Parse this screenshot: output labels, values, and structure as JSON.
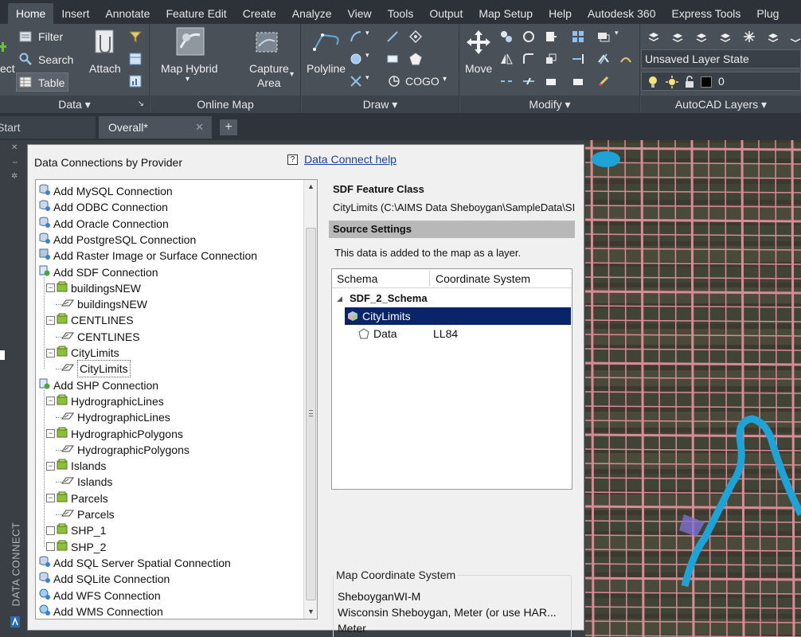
{
  "menu": {
    "tabs": [
      "Home",
      "Insert",
      "Annotate",
      "Feature Edit",
      "Create",
      "Analyze",
      "View",
      "Tools",
      "Output",
      "Map Setup",
      "Help",
      "Autodesk 360",
      "Express Tools",
      "Plug"
    ],
    "active": "Home"
  },
  "ribbon": {
    "data_panel": {
      "title": "Data",
      "connect_label": "ect",
      "filter_label": "Filter",
      "search_label": "Search",
      "table_label": "Table",
      "attach_label": "Attach"
    },
    "online_map_panel": {
      "title": "Online Map",
      "map_hybrid_label": "Map Hybrid",
      "capture_area_label_1": "Capture",
      "capture_area_label_2": "Area"
    },
    "draw_panel": {
      "title": "Draw",
      "polyline_label": "Polyline",
      "cogo_label": "COGO"
    },
    "modify_panel": {
      "title": "Modify",
      "move_label": "Move"
    },
    "layers_panel": {
      "title": "AutoCAD Layers",
      "layer_state": "Unsaved Layer State",
      "current_layer": "0"
    }
  },
  "doc_tabs": {
    "start": "Start",
    "overall": "Overall*"
  },
  "side_label": "DATA CONNECT",
  "dialog": {
    "title": "Data Connections by Provider",
    "help_icon": "?",
    "help_link": "Data Connect help",
    "tree": [
      {
        "label": "Add MySQL Connection",
        "level": 0,
        "icon": "db-connect"
      },
      {
        "label": "Add ODBC Connection",
        "level": 0,
        "icon": "db-connect"
      },
      {
        "label": "Add Oracle Connection",
        "level": 0,
        "icon": "db-connect"
      },
      {
        "label": "Add PostgreSQL Connection",
        "level": 0,
        "icon": "db-connect"
      },
      {
        "label": "Add Raster Image or Surface Connection",
        "level": 0,
        "icon": "raster-connect"
      },
      {
        "label": "Add SDF Connection",
        "level": 0,
        "icon": "file-connect"
      },
      {
        "label": "buildingsNEW",
        "level": 1,
        "icon": "datastore"
      },
      {
        "label": "buildingsNEW",
        "level": 2,
        "icon": "feature-class"
      },
      {
        "label": "CENTLINES",
        "level": 1,
        "icon": "datastore"
      },
      {
        "label": "CENTLINES",
        "level": 2,
        "icon": "feature-class"
      },
      {
        "label": "CityLimits",
        "level": 1,
        "icon": "datastore"
      },
      {
        "label": "CityLimits",
        "level": 2,
        "icon": "feature-class",
        "boxed": true
      },
      {
        "label": "Add SHP Connection",
        "level": 0,
        "icon": "file-connect"
      },
      {
        "label": "HydrographicLines",
        "level": 1,
        "icon": "datastore"
      },
      {
        "label": "HydrographicLines",
        "level": 2,
        "icon": "feature-class"
      },
      {
        "label": "HydrographicPolygons",
        "level": 1,
        "icon": "datastore"
      },
      {
        "label": "HydrographicPolygons",
        "level": 2,
        "icon": "feature-class"
      },
      {
        "label": "Islands",
        "level": 1,
        "icon": "datastore"
      },
      {
        "label": "Islands",
        "level": 2,
        "icon": "feature-class"
      },
      {
        "label": "Parcels",
        "level": 1,
        "icon": "datastore"
      },
      {
        "label": "Parcels",
        "level": 2,
        "icon": "feature-class"
      },
      {
        "label": "SHP_1",
        "level": 1,
        "icon": "datastore",
        "leaf": true
      },
      {
        "label": "SHP_2",
        "level": 1,
        "icon": "datastore",
        "leaf": true
      },
      {
        "label": "Add SQL Server Spatial Connection",
        "level": 0,
        "icon": "db-connect"
      },
      {
        "label": "Add SQLite Connection",
        "level": 0,
        "icon": "db-connect"
      },
      {
        "label": "Add WFS Connection",
        "level": 0,
        "icon": "web-connect"
      },
      {
        "label": "Add WMS Connection",
        "level": 0,
        "icon": "web-connect"
      }
    ],
    "feature_class_heading": "SDF Feature Class",
    "feature_class_value": "CityLimits (C:\\AIMS Data Sheboygan\\SampleData\\SI",
    "source_settings_heading": "Source Settings",
    "source_settings_text": "This data is added to the map as a layer.",
    "grid": {
      "columns": [
        "Schema",
        "Coordinate System"
      ],
      "schema": "SDF_2_Schema",
      "class": "CityLimits",
      "property": "Data",
      "property_cs": "LL84"
    },
    "map_cs": {
      "caption": "Map Coordinate System",
      "code": "SheboyganWI-M",
      "description": "Wisconsin Sheboygan, Meter (or use HAR...",
      "units": "Meter"
    }
  },
  "colors": {
    "ribbon_bg": "#4a5058",
    "menubar_bg": "#2d3239",
    "selection": "#0a246a",
    "link": "#1a3fa0",
    "map_roads": "#d98b95",
    "river": "#1fa3d6"
  }
}
